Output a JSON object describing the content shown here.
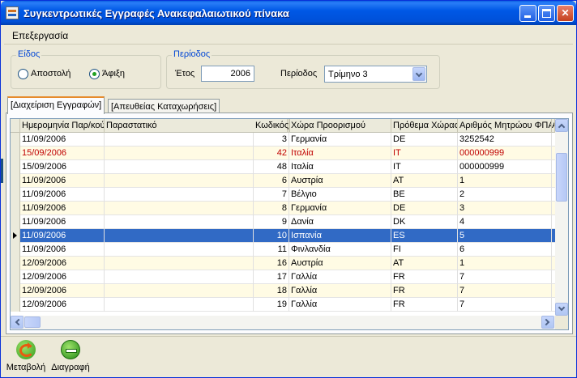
{
  "window": {
    "title": "Συγκεντρωτικές Εγγραφές Ανακεφαλαιωτικού πίνακα",
    "min_glyph": "",
    "max_glyph": "",
    "close_glyph": "✕"
  },
  "menu": {
    "items": [
      "Επεξεργασία"
    ]
  },
  "type_group": {
    "title": "Είδος",
    "options": [
      {
        "label": "Αποστολή",
        "checked": false
      },
      {
        "label": "Άφιξη",
        "checked": true
      }
    ]
  },
  "period_group": {
    "title": "Περίοδος",
    "year_label": "Έτος",
    "year_value": "2006",
    "period_label": "Περίοδος",
    "period_value": "Τρίμηνο 3"
  },
  "tabs": [
    {
      "label": "[Διαχείριση Εγγραφών]",
      "active": true
    },
    {
      "label": "[Απευθείας Καταχωρήσεις]",
      "active": false
    }
  ],
  "grid": {
    "columns": [
      "Ημερομηνία Παρ/κού",
      "Παραστατικό",
      "Κωδικός",
      "Χώρα Προορισμού",
      "Πρόθεμα Χώρας",
      "Αριθμός Μητρώου ΦΠΑ",
      "Α"
    ],
    "rows": [
      [
        "11/09/2006",
        "",
        "3",
        "Γερμανία",
        "DE",
        "3252542"
      ],
      [
        "15/09/2006",
        "",
        "42",
        "Ιταλία",
        "IT",
        "000000999"
      ],
      [
        "15/09/2006",
        "",
        "48",
        "Ιταλία",
        "IT",
        "000000999"
      ],
      [
        "11/09/2006",
        "",
        "6",
        "Αυστρία",
        "AT",
        "1"
      ],
      [
        "11/09/2006",
        "",
        "7",
        "Βέλγιο",
        "BE",
        "2"
      ],
      [
        "11/09/2006",
        "",
        "8",
        "Γερμανία",
        "DE",
        "3"
      ],
      [
        "11/09/2006",
        "",
        "9",
        "Δανία",
        "DK",
        "4"
      ],
      [
        "11/09/2006",
        "",
        "10",
        "Ισπανία",
        "ES",
        "5"
      ],
      [
        "11/09/2006",
        "",
        "11",
        "Φινλανδία",
        "FI",
        "6"
      ],
      [
        "12/09/2006",
        "",
        "16",
        "Αυστρία",
        "AT",
        "1"
      ],
      [
        "12/09/2006",
        "",
        "17",
        "Γαλλία",
        "FR",
        "7"
      ],
      [
        "12/09/2006",
        "",
        "18",
        "Γαλλία",
        "FR",
        "7"
      ],
      [
        "12/09/2006",
        "",
        "19",
        "Γαλλία",
        "FR",
        "7"
      ]
    ],
    "selected_row": 7,
    "highlighted_row": 1,
    "colors": {
      "selected": "#316ac5",
      "alt_row": "#fffbe4",
      "highlight_text": "#c00000"
    }
  },
  "toolbar": {
    "edit_label": "Μεταβολή",
    "delete_label": "Διαγραφή"
  }
}
